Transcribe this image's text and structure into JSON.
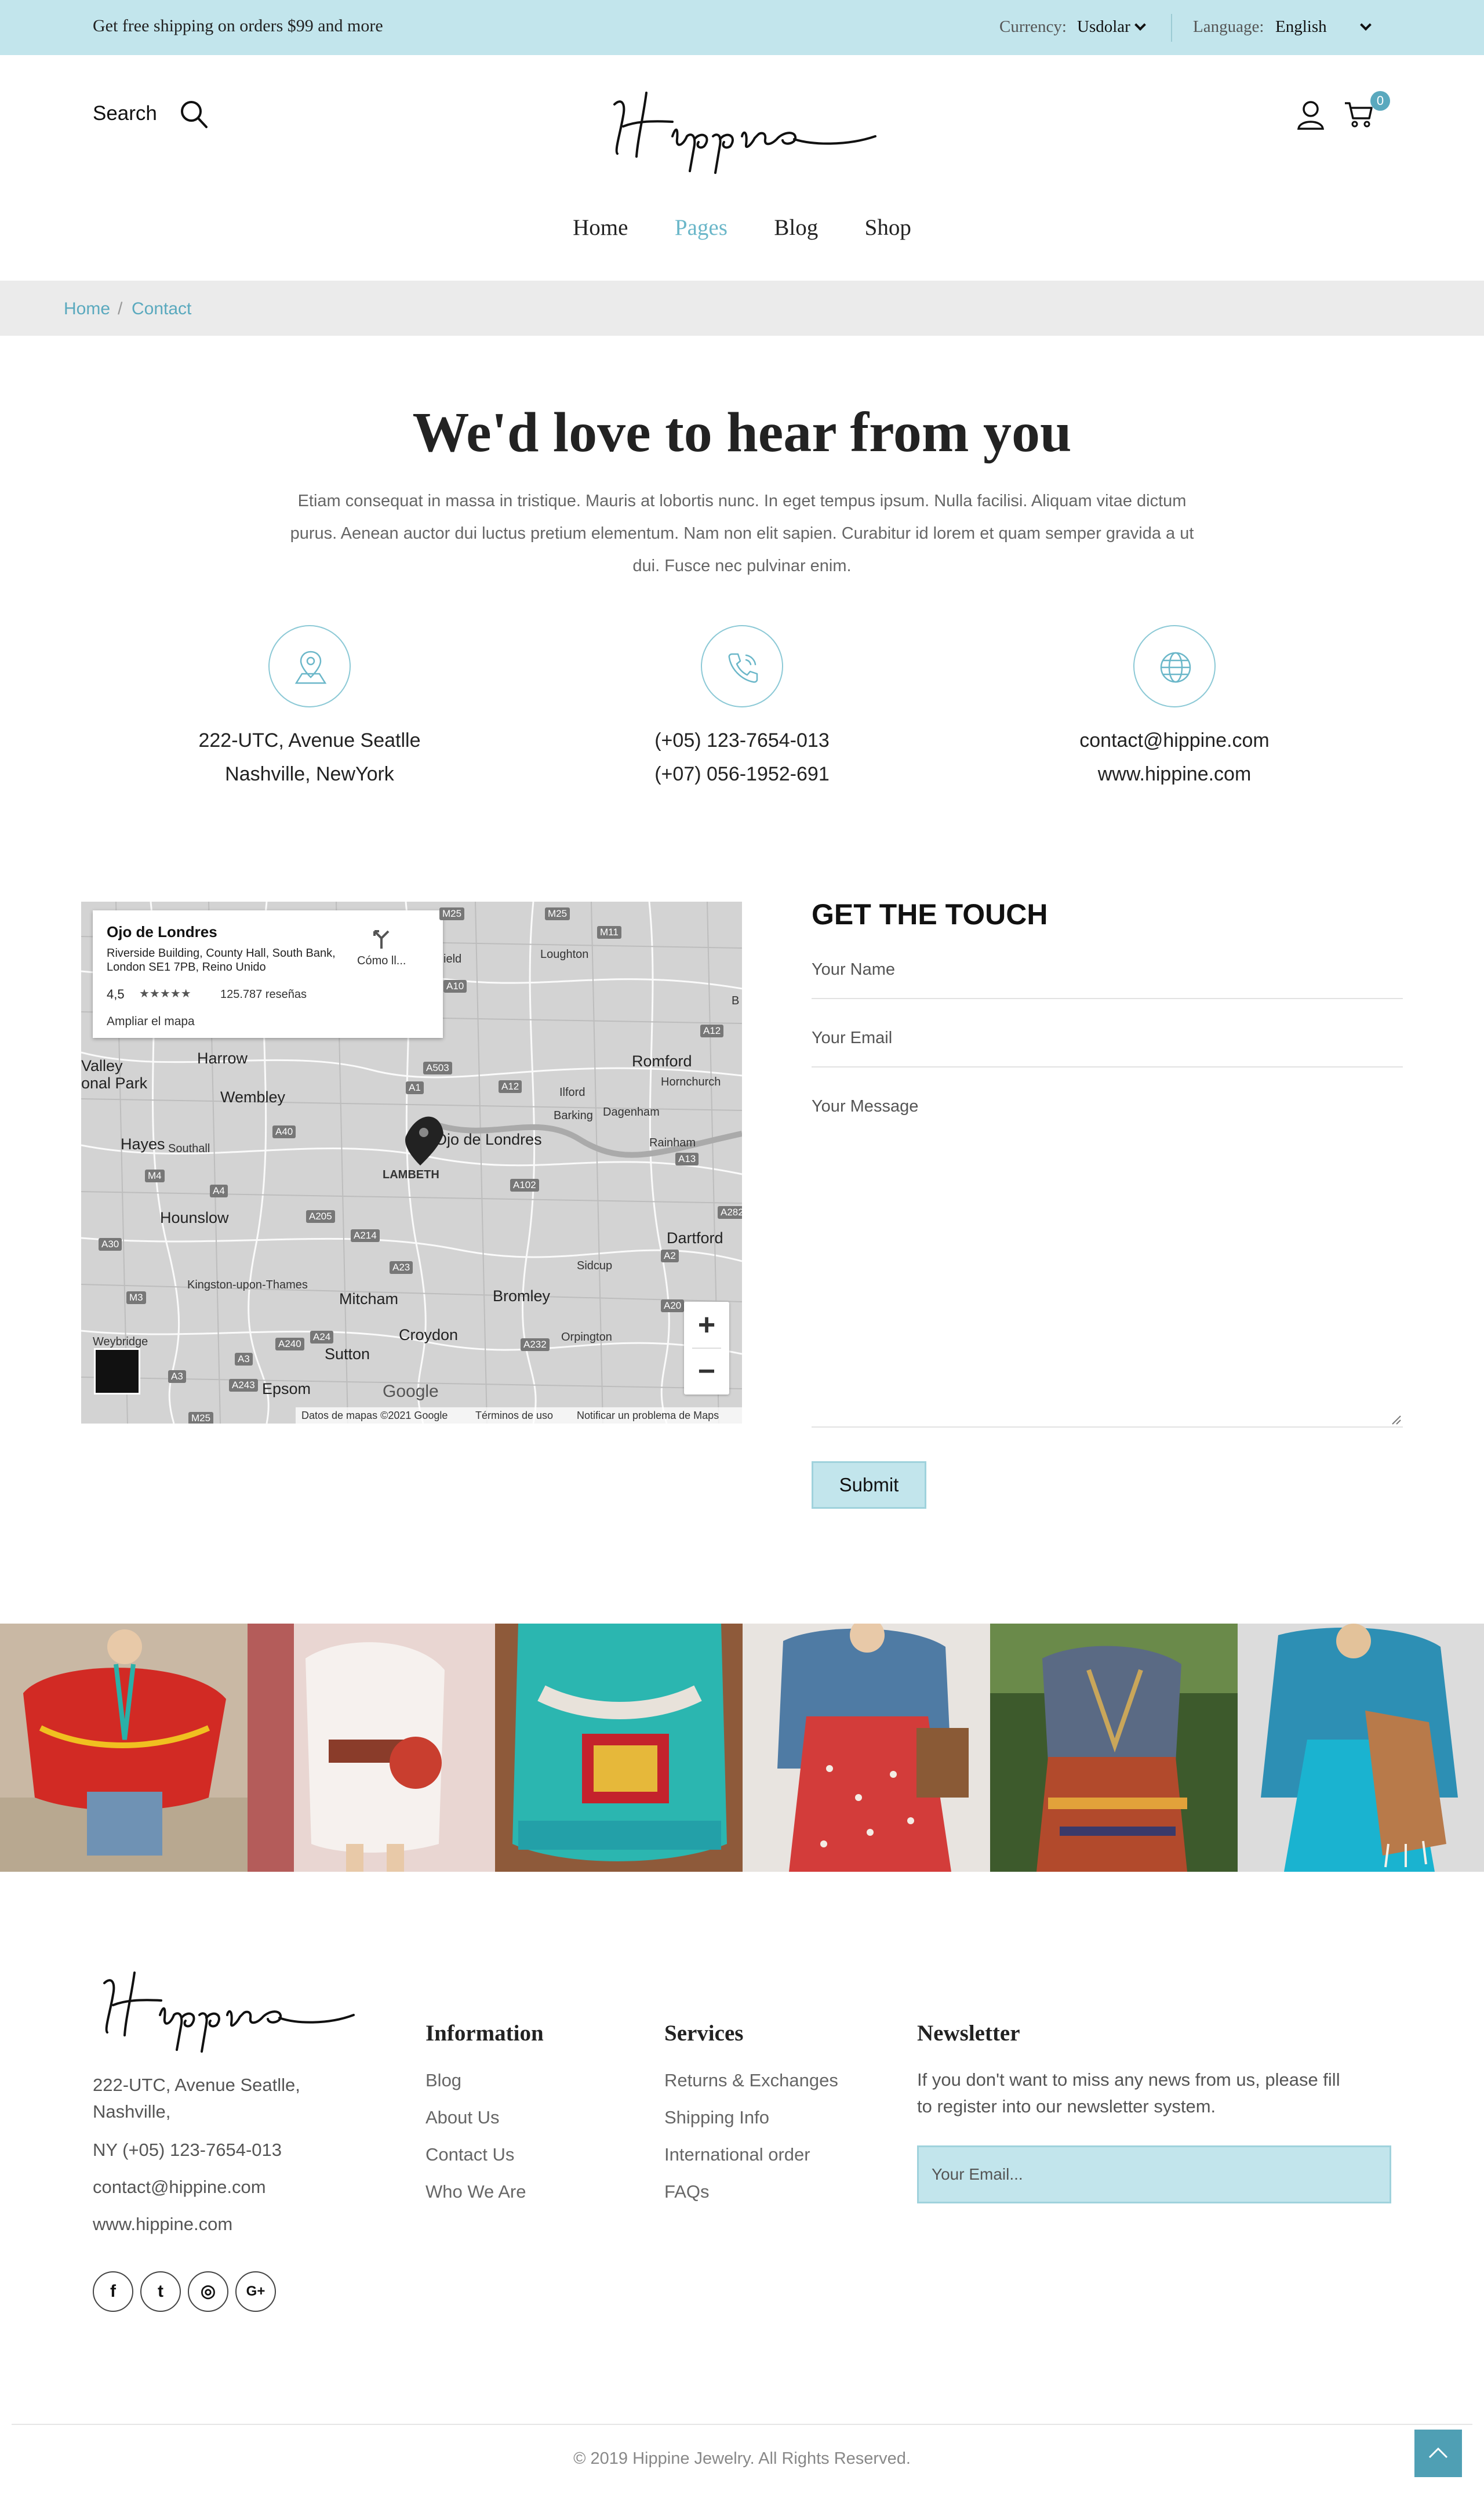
{
  "topbar": {
    "shipping_text": "Get free shipping on orders $99 and more",
    "currency_label": "Currency:",
    "currency_value": "Usdolar",
    "language_label": "Language:",
    "language_value": "English",
    "bg_color": "#c2e5ec"
  },
  "header": {
    "search_label": "Search",
    "logo_text": "Hippine",
    "cart_count": "0"
  },
  "nav": {
    "items": [
      {
        "label": "Home",
        "active": false
      },
      {
        "label": "Pages",
        "active": true
      },
      {
        "label": "Blog",
        "active": false
      },
      {
        "label": "Shop",
        "active": false
      }
    ]
  },
  "breadcrumb": {
    "home": "Home",
    "separator": "/",
    "current": "Contact"
  },
  "hero": {
    "title": "We'd love to hear from you",
    "intro": "Etiam consequat in massa in tristique. Mauris at lobortis nunc. In eget tempus ipsum. Nulla facilisi. Aliquam vitae dictum purus. Aenean auctor dui luctus pretium elementum. Nam non elit sapien. Curabitur id lorem et quam semper gravida a ut dui. Fusce nec pulvinar enim."
  },
  "contact_info": {
    "address_line1": "222-UTC, Avenue Seatlle",
    "address_line2": "Nashville, NewYork",
    "phone_line1": "(+05) 123-7654-013",
    "phone_line2": "(+07) 056-1952-691",
    "email": "contact@hippine.com",
    "website": "www.hippine.com"
  },
  "map": {
    "place_name": "Ojo de Londres",
    "place_address": "Riverside Building, County Hall, South Bank, London SE1 7PB, Reino Unido",
    "rating": "4,5",
    "stars": "★★★★★",
    "reviews": "125.787 reseñas",
    "enlarge_link": "Ampliar el mapa",
    "directions_label": "Cómo ll...",
    "marker_label": "Ojo de Londres",
    "district_label": "LAMBETH",
    "places": [
      "Harrow",
      "Wembley",
      "Hayes",
      "Southall",
      "Hounslow",
      "Kingston-upon-Thames",
      "Mitcham",
      "Croydon",
      "Sutton",
      "Epsom",
      "Weybridge",
      "Bromley",
      "Orpington",
      "Sidcup",
      "Dartford",
      "Romford",
      "Hornchurch",
      "Ilford",
      "Barking",
      "Dagenham",
      "Rainham",
      "Loughton",
      "Valley",
      "onal Park",
      "ield",
      "B"
    ],
    "roads": [
      "M25",
      "M25",
      "M11",
      "A10",
      "A12",
      "A503",
      "A1",
      "A12",
      "A40",
      "A4",
      "M4",
      "A205",
      "A214",
      "A102",
      "A13",
      "A23",
      "A24",
      "A240",
      "A3",
      "A243",
      "A232",
      "A20",
      "A2",
      "A282",
      "A30",
      "M3",
      "A3",
      "M25"
    ],
    "zoom_in": "+",
    "zoom_out": "−",
    "footer_data": "Datos de mapas ©2021 Google",
    "footer_terms": "Términos de uso",
    "footer_report": "Notificar un problema de Maps",
    "google_brand": "Google"
  },
  "form": {
    "title": "GET THE TOUCH",
    "name_placeholder": "Your Name",
    "email_placeholder": "Your Email",
    "message_placeholder": "Your Message",
    "submit_label": "Submit"
  },
  "footer": {
    "logo_text": "Hippine",
    "address_line1": "222-UTC, Avenue Seatlle,",
    "address_line2": "Nashville,",
    "phone": "NY (+05) 123-7654-013",
    "email": "contact@hippine.com",
    "website": "www.hippine.com",
    "information": {
      "heading": "Information",
      "links": [
        "Blog",
        "About Us",
        "Contact Us",
        "Who We Are"
      ]
    },
    "services": {
      "heading": "Services",
      "links": [
        "Returns & Exchanges",
        "Shipping Info",
        "International order",
        "FAQs"
      ]
    },
    "newsletter": {
      "heading": "Newsletter",
      "text": "If you don't want to miss any news from us, please fill to register into our newsletter system.",
      "placeholder": "Your Email..."
    },
    "social": [
      {
        "icon": "facebook-icon",
        "glyph": "f"
      },
      {
        "icon": "twitter-icon",
        "glyph": "t"
      },
      {
        "icon": "instagram-icon",
        "glyph": "◎"
      },
      {
        "icon": "google-plus-icon",
        "glyph": "G+"
      }
    ],
    "copyright": "© 2019 Hippine Jewelry. All Rights Reserved."
  },
  "colors": {
    "accent": "#5aa9be",
    "light_accent": "#c2e5ec",
    "text_dark": "#222222",
    "text_muted": "#666666"
  }
}
